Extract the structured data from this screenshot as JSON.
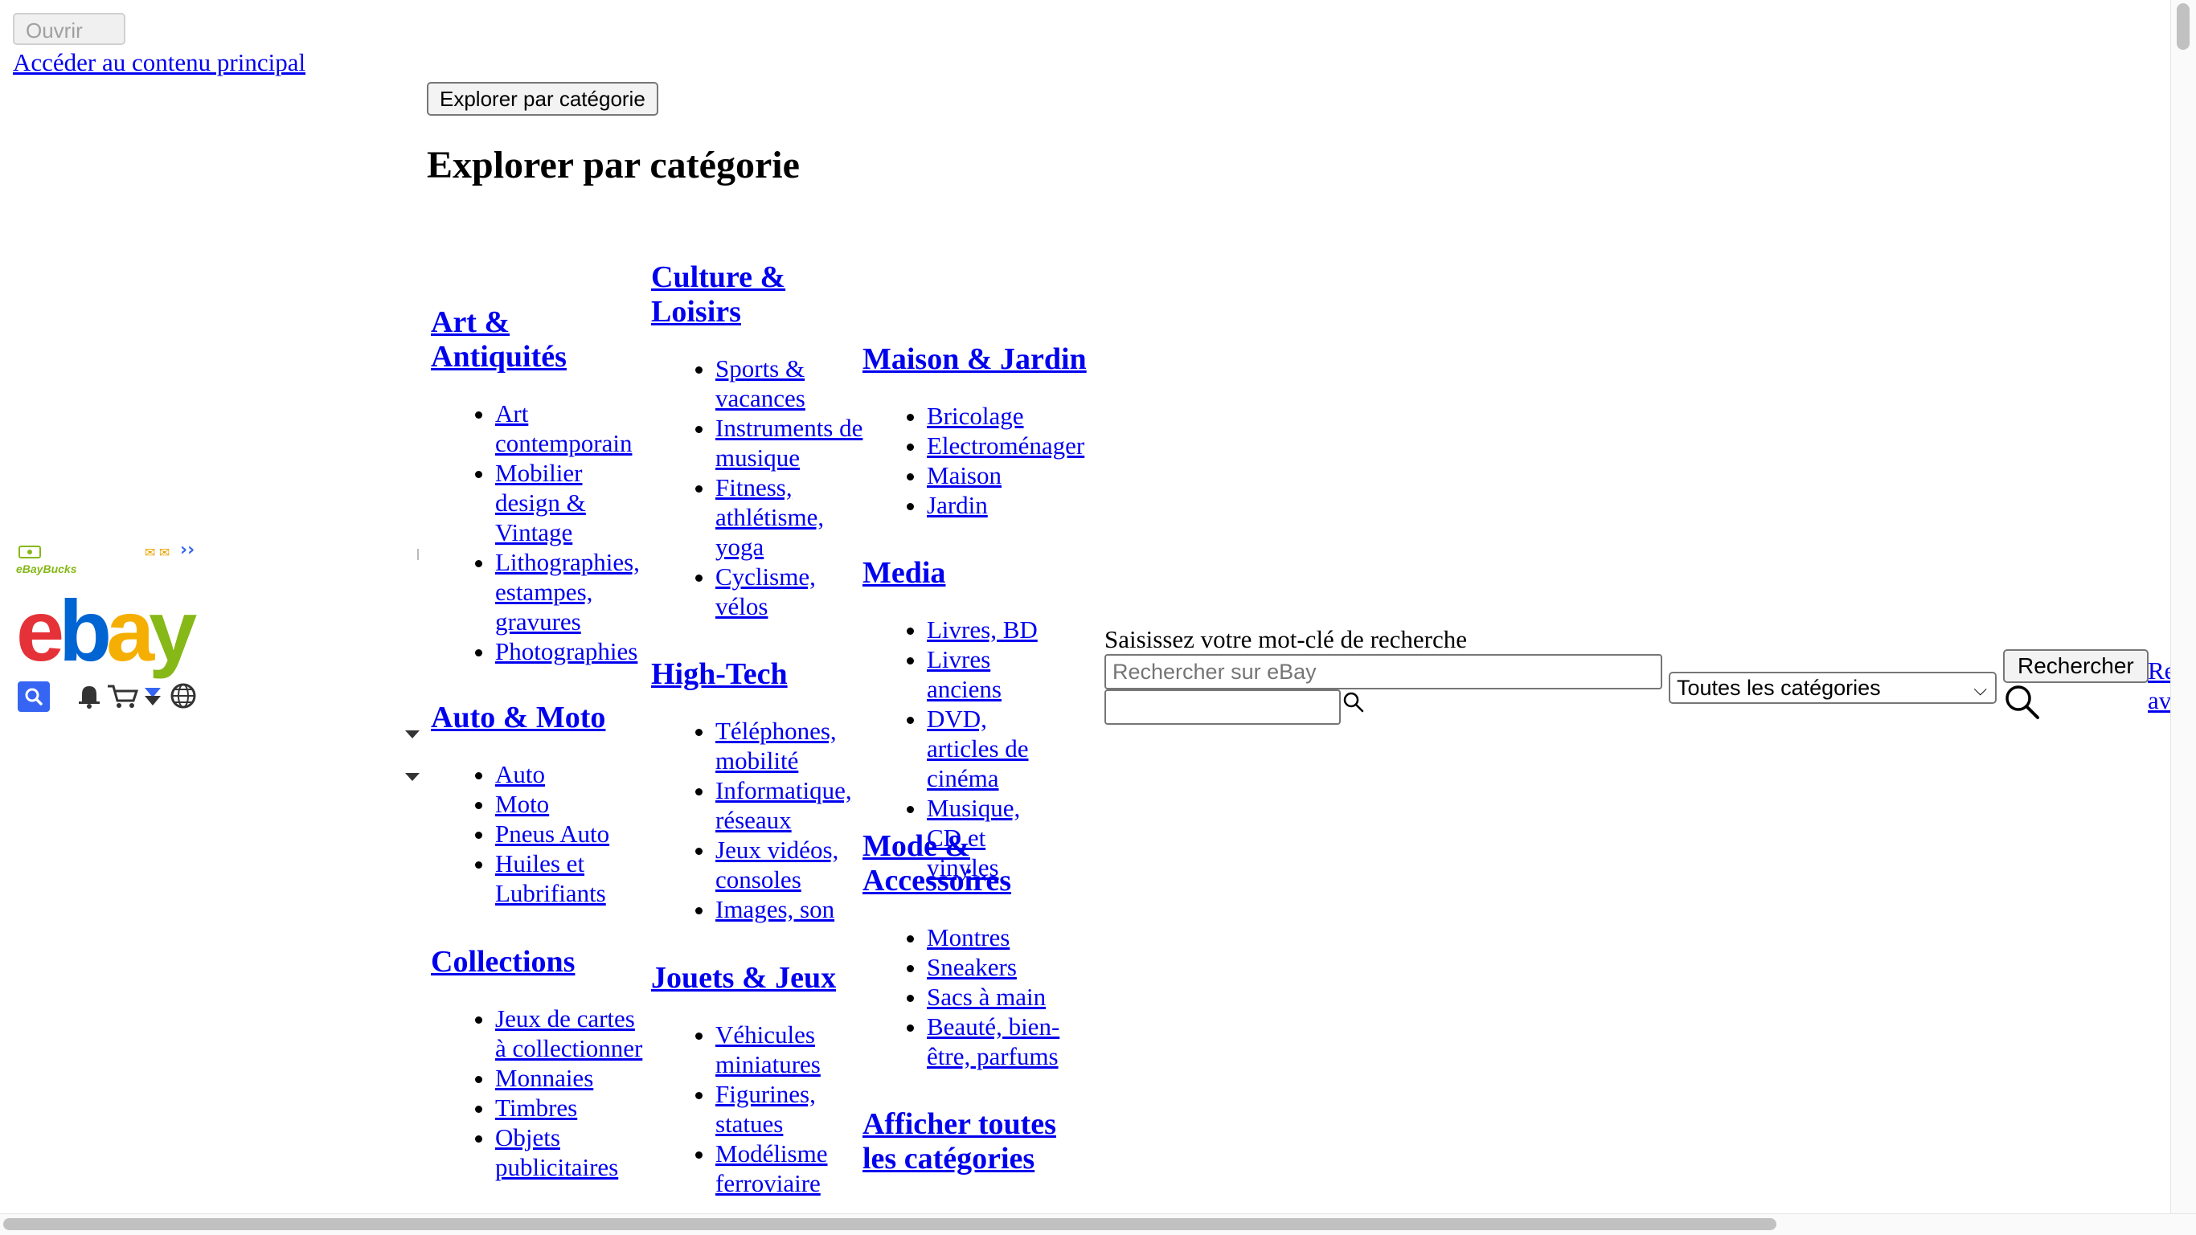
{
  "top": {
    "open_button": "Ouvrir",
    "skip_link": "Accéder au contenu principal"
  },
  "explore": {
    "button_label": "Explorer par catégorie",
    "title": "Explorer par catégorie"
  },
  "categories": {
    "art": {
      "title": "Art & Antiquités",
      "items": [
        "Art contemporain",
        "Mobilier design & Vintage",
        "Lithographies, estampes, gravures",
        "Photographies"
      ]
    },
    "auto": {
      "title": "Auto & Moto",
      "items": [
        "Auto",
        "Moto",
        "Pneus Auto",
        "Huiles et Lubrifiants"
      ]
    },
    "collections": {
      "title": "Collections",
      "items": [
        "Jeux de cartes à collectionner",
        "Monnaies",
        "Timbres",
        "Objets publicitaires"
      ]
    },
    "culture": {
      "title": "Culture & Loisirs",
      "items": [
        "Sports & vacances",
        "Instruments de musique",
        "Fitness, athlétisme, yoga",
        "Cyclisme, vélos"
      ]
    },
    "hightech": {
      "title": "High-Tech",
      "items": [
        "Téléphones, mobilité",
        "Informatique, réseaux",
        "Jeux vidéos, consoles",
        "Images, son"
      ]
    },
    "jouets": {
      "title": "Jouets & Jeux",
      "items": [
        "Véhicules miniatures",
        "Figurines, statues",
        "Modélisme ferroviaire"
      ]
    },
    "maison": {
      "title": "Maison & Jardin",
      "items": [
        "Bricolage",
        "Electroménager",
        "Maison",
        "Jardin"
      ]
    },
    "media": {
      "title": "Media",
      "items": [
        "Livres, BD",
        "Livres anciens",
        "DVD, articles de cinéma",
        "Musique, CD et vinyles"
      ]
    },
    "mode": {
      "title": "Mode & Accessoires",
      "items": [
        "Montres",
        "Sneakers",
        "Sacs à main",
        "Beauté, bien-être, parfums"
      ]
    },
    "all": {
      "title": "Afficher toutes les catégories"
    }
  },
  "brand": {
    "bucks_label": "eBayBucks",
    "logo_letters": [
      "e",
      "b",
      "a",
      "y"
    ]
  },
  "search": {
    "label": "Saisissez votre mot-clé de recherche",
    "placeholder": "Rechercher sur eBay",
    "category_selected": "Toutes les catégories",
    "button_label": "Rechercher",
    "advanced_link": "Recherche avancée"
  },
  "icons": {
    "search": "search-icon",
    "bell": "bell-icon",
    "cart": "cart-icon",
    "globe": "globe-icon",
    "magnifier": "magnifier-icon"
  },
  "colors": {
    "link": "#0000ee",
    "ebay_red": "#e53238",
    "ebay_blue": "#0064d2",
    "ebay_yellow": "#f5af02",
    "ebay_green": "#86b817"
  }
}
